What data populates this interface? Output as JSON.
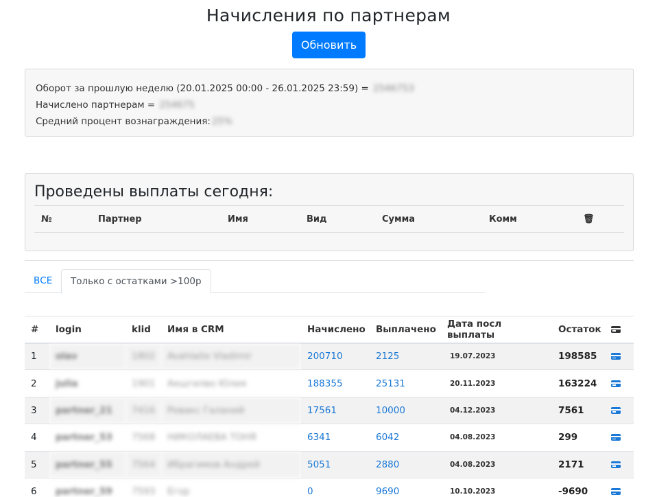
{
  "page": {
    "title": "Начисления по партнерам",
    "refresh_label": "Обновить"
  },
  "summary": {
    "turnover_label": "Оборот за прошлую неделю (20.01.2025 00:00 - 26.01.2025 23:59) =",
    "turnover_value": "2546753",
    "accrued_label": "Начислено партнерам =",
    "accrued_value": "254675",
    "percent_label": "Средний процент вознаграждения:",
    "percent_value": "25%"
  },
  "payouts": {
    "title": "Проведены выплаты сегодня:",
    "columns": [
      "№",
      "Партнер",
      "Имя",
      "Вид",
      "Сумма",
      "Комм"
    ],
    "delete_icon": "trash-icon"
  },
  "tabs": [
    {
      "label": "ВСЕ"
    },
    {
      "label": "Только с остатками >100р"
    }
  ],
  "table": {
    "columns": [
      "#",
      "login",
      "klid",
      "Имя в CRM",
      "Начислено",
      "Выплачено",
      "Дата посл выплаты",
      "Остаток"
    ],
    "pay_icon": "credit-card-icon",
    "rows": [
      {
        "n": "1",
        "login": "olav",
        "klid": "1802",
        "crm": "Avahlaite Vladimir",
        "accrued": "200710",
        "paid": "2125",
        "date": "19.07.2023",
        "rest": "198585"
      },
      {
        "n": "2",
        "login": "julia",
        "klid": "1901",
        "crm": "Аешгилво Юлия",
        "accrued": "188355",
        "paid": "25131",
        "date": "20.11.2023",
        "rest": "163224"
      },
      {
        "n": "3",
        "login": "partner_21",
        "klid": "7416",
        "crm": "Ревакс Галаний",
        "accrued": "17561",
        "paid": "10000",
        "date": "04.12.2023",
        "rest": "7561"
      },
      {
        "n": "4",
        "login": "partner_53",
        "klid": "7568",
        "crm": "НИКОЛАЕВА ТОНЯ",
        "accrued": "6341",
        "paid": "6042",
        "date": "04.08.2023",
        "rest": "299"
      },
      {
        "n": "5",
        "login": "partner_55",
        "klid": "7564",
        "crm": "Ибрагимов Андрей",
        "accrued": "5051",
        "paid": "2880",
        "date": "04.08.2023",
        "rest": "2171"
      },
      {
        "n": "6",
        "login": "partner_59",
        "klid": "7593",
        "crm": "Егор",
        "accrued": "0",
        "paid": "9690",
        "date": "10.10.2023",
        "rest": "-9690"
      }
    ]
  },
  "colors": {
    "primary": "#007bff",
    "link": "#1a78d6",
    "card_bg": "#f7f7f7",
    "stripe": "#f2f2f2"
  }
}
